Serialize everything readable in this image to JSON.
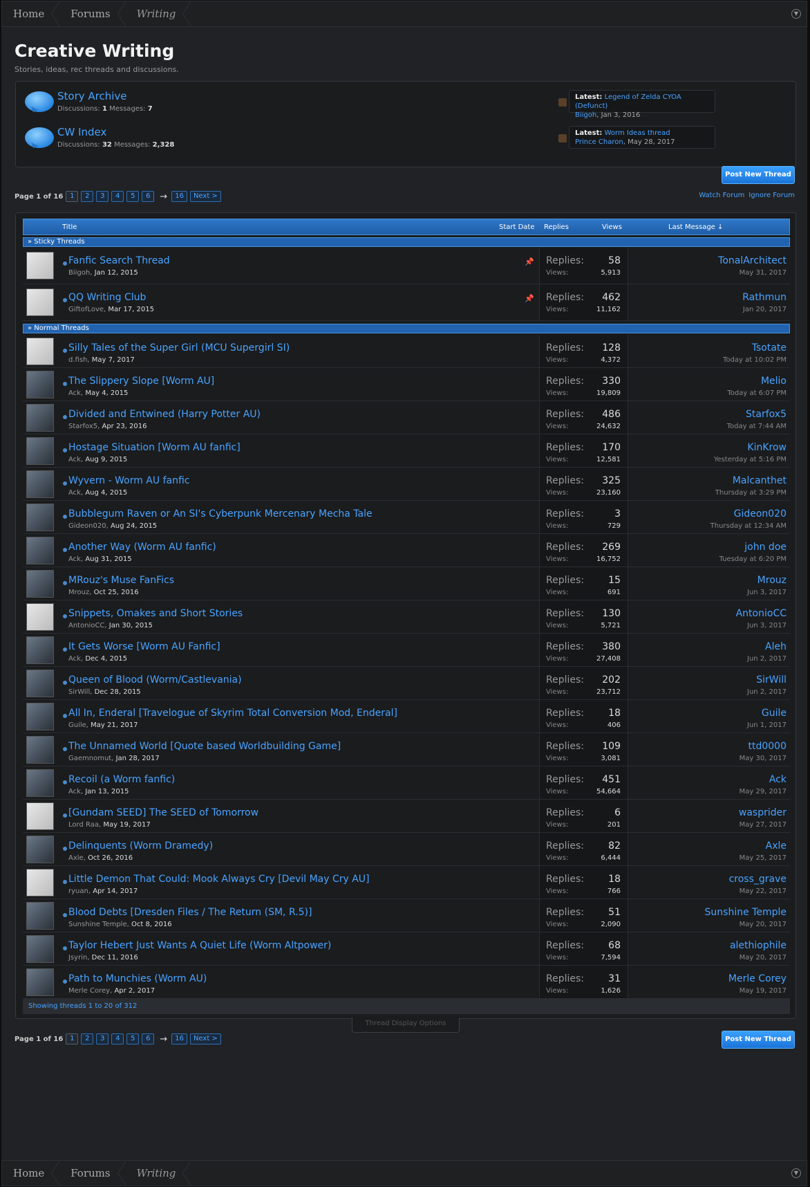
{
  "breadcrumbs": [
    "Home",
    "Forums",
    "Writing"
  ],
  "forum": {
    "title": "Creative Writing",
    "description": "Stories, ideas, rec threads and discussions."
  },
  "subforums": [
    {
      "title": "Story Archive",
      "discussions": "1",
      "messages": "7",
      "latest_label": "Latest:",
      "latest_thread": "Legend of Zelda CYOA (Defunct)",
      "latest_user": "Biigoh",
      "latest_date": ", Jan 3, 2016"
    },
    {
      "title": "CW Index",
      "discussions": "32",
      "messages": "2,328",
      "latest_label": "Latest:",
      "latest_thread": "Worm Ideas thread",
      "latest_user": "Prince Charon",
      "latest_date": ", May 28, 2017"
    }
  ],
  "labels": {
    "discussions": "Discussions:",
    "messages": "Messages:",
    "post_new_thread": "Post New Thread",
    "page_of": "Page 1 of 16",
    "next": "Next >",
    "arrow": "→",
    "watch_forum": "Watch Forum",
    "ignore_forum": "Ignore Forum",
    "replies": "Replies:",
    "views": "Views:",
    "thread_display_options": "Thread Display Options",
    "showing": "Showing threads 1 to 20 of 312"
  },
  "pages": [
    "1",
    "2",
    "3",
    "4",
    "5",
    "6",
    "16"
  ],
  "columns": {
    "title": "Title",
    "start_date": "Start Date",
    "replies": "Replies",
    "views": "Views",
    "last_message": "Last Message ↓"
  },
  "sections": {
    "sticky": "» Sticky Threads",
    "normal": "» Normal Threads"
  },
  "sticky_threads": [
    {
      "title": "Fanfic Search Thread",
      "author": "Biigoh",
      "date": "Jan 12, 2015",
      "replies": "58",
      "views": "5,913",
      "last_user": "TonalArchitect",
      "last_date": "May 31, 2017"
    },
    {
      "title": "QQ Writing Club",
      "author": "GiftofLove",
      "date": "Mar 17, 2015",
      "replies": "462",
      "views": "11,162",
      "last_user": "Rathmun",
      "last_date": "Jan 20, 2017"
    }
  ],
  "threads": [
    {
      "title": "Silly Tales of the Super Girl (MCU Supergirl SI)",
      "author": "d.fish",
      "date": "May 7, 2017",
      "replies": "128",
      "views": "4,372",
      "last_user": "Tsotate",
      "last_date": "Today at 10:02 PM"
    },
    {
      "title": "The Slippery Slope [Worm AU]",
      "author": "Ack",
      "date": "May 4, 2015",
      "replies": "330",
      "views": "19,809",
      "last_user": "Melio",
      "last_date": "Today at 6:07 PM"
    },
    {
      "title": "Divided and Entwined (Harry Potter AU)",
      "author": "Starfox5",
      "date": "Apr 23, 2016",
      "replies": "486",
      "views": "24,632",
      "last_user": "Starfox5",
      "last_date": "Today at 7:44 AM"
    },
    {
      "title": "Hostage Situation [Worm AU fanfic]",
      "author": "Ack",
      "date": "Aug 9, 2015",
      "replies": "170",
      "views": "12,581",
      "last_user": "KinKrow",
      "last_date": "Yesterday at 5:16 PM"
    },
    {
      "title": "Wyvern - Worm AU fanfic",
      "author": "Ack",
      "date": "Aug 4, 2015",
      "replies": "325",
      "views": "23,160",
      "last_user": "Malcanthet",
      "last_date": "Thursday at 3:29 PM"
    },
    {
      "title": "Bubblegum Raven or An SI's Cyberpunk Mercenary Mecha Tale",
      "author": "Gideon020",
      "date": "Aug 24, 2015",
      "replies": "3",
      "views": "729",
      "last_user": "Gideon020",
      "last_date": "Thursday at 12:34 AM"
    },
    {
      "title": "Another Way (Worm AU fanfic)",
      "author": "Ack",
      "date": "Aug 31, 2015",
      "replies": "269",
      "views": "16,752",
      "last_user": "john doe",
      "last_date": "Tuesday at 6:20 PM"
    },
    {
      "title": "MRouz's Muse FanFics",
      "author": "Mrouz",
      "date": "Oct 25, 2016",
      "replies": "15",
      "views": "691",
      "last_user": "Mrouz",
      "last_date": "Jun 3, 2017"
    },
    {
      "title": "Snippets, Omakes and Short Stories",
      "author": "AntonioCC",
      "date": "Jan 30, 2015",
      "replies": "130",
      "views": "5,721",
      "last_user": "AntonioCC",
      "last_date": "Jun 3, 2017"
    },
    {
      "title": "It Gets Worse [Worm AU Fanfic]",
      "author": "Ack",
      "date": "Dec 4, 2015",
      "replies": "380",
      "views": "27,408",
      "last_user": "Aleh",
      "last_date": "Jun 2, 2017"
    },
    {
      "title": "Queen of Blood (Worm/Castlevania)",
      "author": "SirWill",
      "date": "Dec 28, 2015",
      "replies": "202",
      "views": "23,712",
      "last_user": "SirWill",
      "last_date": "Jun 2, 2017"
    },
    {
      "title": "All In, Enderal [Travelogue of Skyrim Total Conversion Mod, Enderal]",
      "author": "Guile",
      "date": "May 21, 2017",
      "replies": "18",
      "views": "406",
      "last_user": "Guile",
      "last_date": "Jun 1, 2017"
    },
    {
      "title": "The Unnamed World [Quote based Worldbuilding Game]",
      "author": "Gaemnomut",
      "date": "Jan 28, 2017",
      "replies": "109",
      "views": "3,081",
      "last_user": "ttd0000",
      "last_date": "May 30, 2017"
    },
    {
      "title": "Recoil (a Worm fanfic)",
      "author": "Ack",
      "date": "Jan 13, 2015",
      "replies": "451",
      "views": "54,664",
      "last_user": "Ack",
      "last_date": "May 29, 2017"
    },
    {
      "title": "[Gundam SEED] The SEED of Tomorrow",
      "author": "Lord Raa",
      "date": "May 19, 2017",
      "replies": "6",
      "views": "201",
      "last_user": "wasprider",
      "last_date": "May 27, 2017"
    },
    {
      "title": "Delinquents (Worm Dramedy)",
      "author": "Axle",
      "date": "Oct 26, 2016",
      "replies": "82",
      "views": "6,444",
      "last_user": "Axle",
      "last_date": "May 25, 2017"
    },
    {
      "title": "Little Demon That Could: Mook Always Cry [Devil May Cry AU]",
      "author": "ryuan",
      "date": "Apr 14, 2017",
      "replies": "18",
      "views": "766",
      "last_user": "cross_grave",
      "last_date": "May 22, 2017"
    },
    {
      "title": "Blood Debts [Dresden Files / The Return (SM, R.5)]",
      "author": "Sunshine Temple",
      "date": "Oct 8, 2016",
      "replies": "51",
      "views": "2,090",
      "last_user": "Sunshine Temple",
      "last_date": "May 20, 2017"
    },
    {
      "title": "Taylor Hebert Just Wants A Quiet Life (Worm Altpower)",
      "author": "Jsyrin",
      "date": "Dec 11, 2016",
      "replies": "68",
      "views": "7,594",
      "last_user": "alethiophile",
      "last_date": "May 20, 2017"
    },
    {
      "title": "Path to Munchies (Worm AU)",
      "author": "Merle Corey",
      "date": "Apr 2, 2017",
      "replies": "31",
      "views": "1,626",
      "last_user": "Merle Corey",
      "last_date": "May 19, 2017"
    }
  ]
}
